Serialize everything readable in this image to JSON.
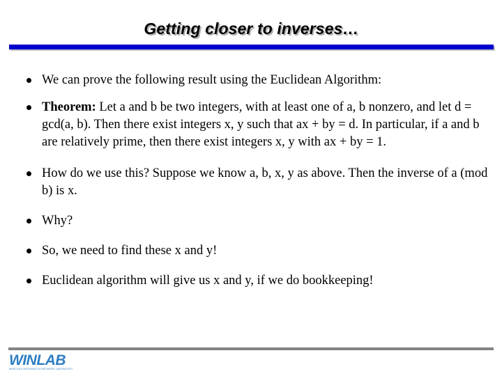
{
  "slide": {
    "title": "Getting closer to inverses…",
    "accent_color": "#0000cc",
    "footer_rule_color": "#848484",
    "logo_color": "#2e7ec4",
    "background_color": "#ffffff",
    "bullets": [
      {
        "lead": "",
        "text": "We can prove the following result using the Euclidean Algorithm:"
      },
      {
        "lead": "Theorem:",
        "text": " Let a and b be two integers, with at least one of a, b nonzero, and let d = gcd(a, b). Then there exist integers x, y such that ax + by = d. In particular, if a and b are relatively prime, then there exist integers x, y with ax + by = 1."
      },
      {
        "lead": "",
        "text": "How do we use this? Suppose we know a, b, x, y as above. Then the inverse of  a (mod b)  is  x."
      },
      {
        "lead": "",
        "text": "Why?"
      },
      {
        "lead": "",
        "text": "So, we need to find these x and y!"
      },
      {
        "lead": "",
        "text": "Euclidean algorithm will give us x and y, if we do bookkeeping!"
      }
    ]
  },
  "footer": {
    "logo_wordmark": "WINLAB",
    "logo_tagline": "WIRELESS INFORMATION NETWORK LABORATORY"
  }
}
